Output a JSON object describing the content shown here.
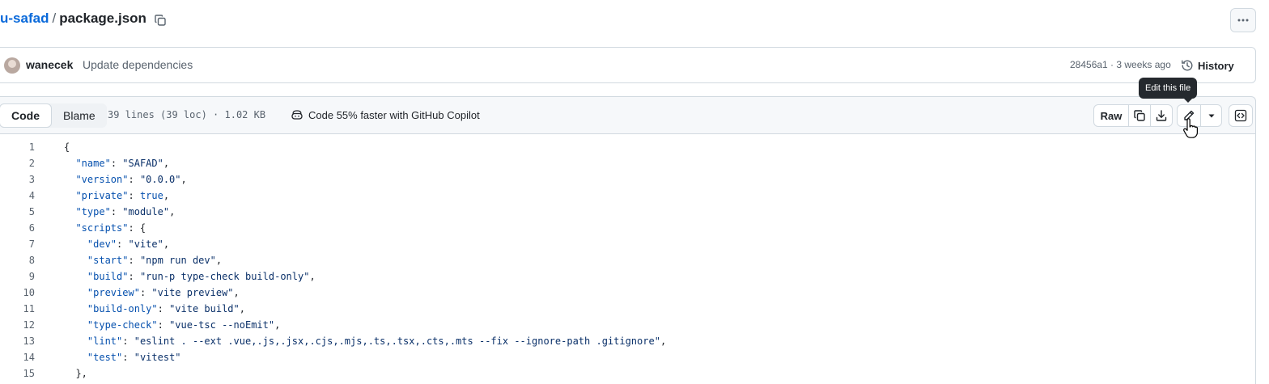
{
  "breadcrumb": {
    "repo": "u-safad",
    "separator": "/",
    "file": "package.json"
  },
  "commit": {
    "author": "wanecek",
    "message": "Update dependencies",
    "meta": "28456a1 · 3 weeks ago",
    "history_label": "History"
  },
  "file_header": {
    "tab_code": "Code",
    "tab_blame": "Blame",
    "info": "39 lines (39 loc) · 1.02 KB",
    "copilot": "Code 55% faster with GitHub Copilot",
    "raw_label": "Raw",
    "tooltip": "Edit this file"
  },
  "code_lines": [
    {
      "n": "1",
      "t": "{"
    },
    {
      "n": "2",
      "t": "  \"name\": \"SAFAD\","
    },
    {
      "n": "3",
      "t": "  \"version\": \"0.0.0\","
    },
    {
      "n": "4",
      "t": "  \"private\": true,"
    },
    {
      "n": "5",
      "t": "  \"type\": \"module\","
    },
    {
      "n": "6",
      "t": "  \"scripts\": {"
    },
    {
      "n": "7",
      "t": "    \"dev\": \"vite\","
    },
    {
      "n": "8",
      "t": "    \"start\": \"npm run dev\","
    },
    {
      "n": "9",
      "t": "    \"build\": \"run-p type-check build-only\","
    },
    {
      "n": "10",
      "t": "    \"preview\": \"vite preview\","
    },
    {
      "n": "11",
      "t": "    \"build-only\": \"vite build\","
    },
    {
      "n": "12",
      "t": "    \"type-check\": \"vue-tsc --noEmit\","
    },
    {
      "n": "13",
      "t": "    \"lint\": \"eslint . --ext .vue,.js,.jsx,.cjs,.mjs,.ts,.tsx,.cts,.mts --fix --ignore-path .gitignore\","
    },
    {
      "n": "14",
      "t": "    \"test\": \"vitest\""
    },
    {
      "n": "15",
      "t": "  },"
    }
  ],
  "icons": {
    "copy": "copy-icon",
    "kebab": "kebab-horizontal-icon",
    "history": "history-icon",
    "copilot": "copilot-icon",
    "download": "download-icon",
    "pencil": "pencil-icon",
    "triangle": "triangle-down-icon",
    "symbols": "code-square-icon",
    "cursor": "hand-pointer-icon"
  },
  "colors": {
    "link": "#0969da",
    "json_key": "#0550ae",
    "json_string": "#0a3069",
    "muted": "#59636e"
  }
}
